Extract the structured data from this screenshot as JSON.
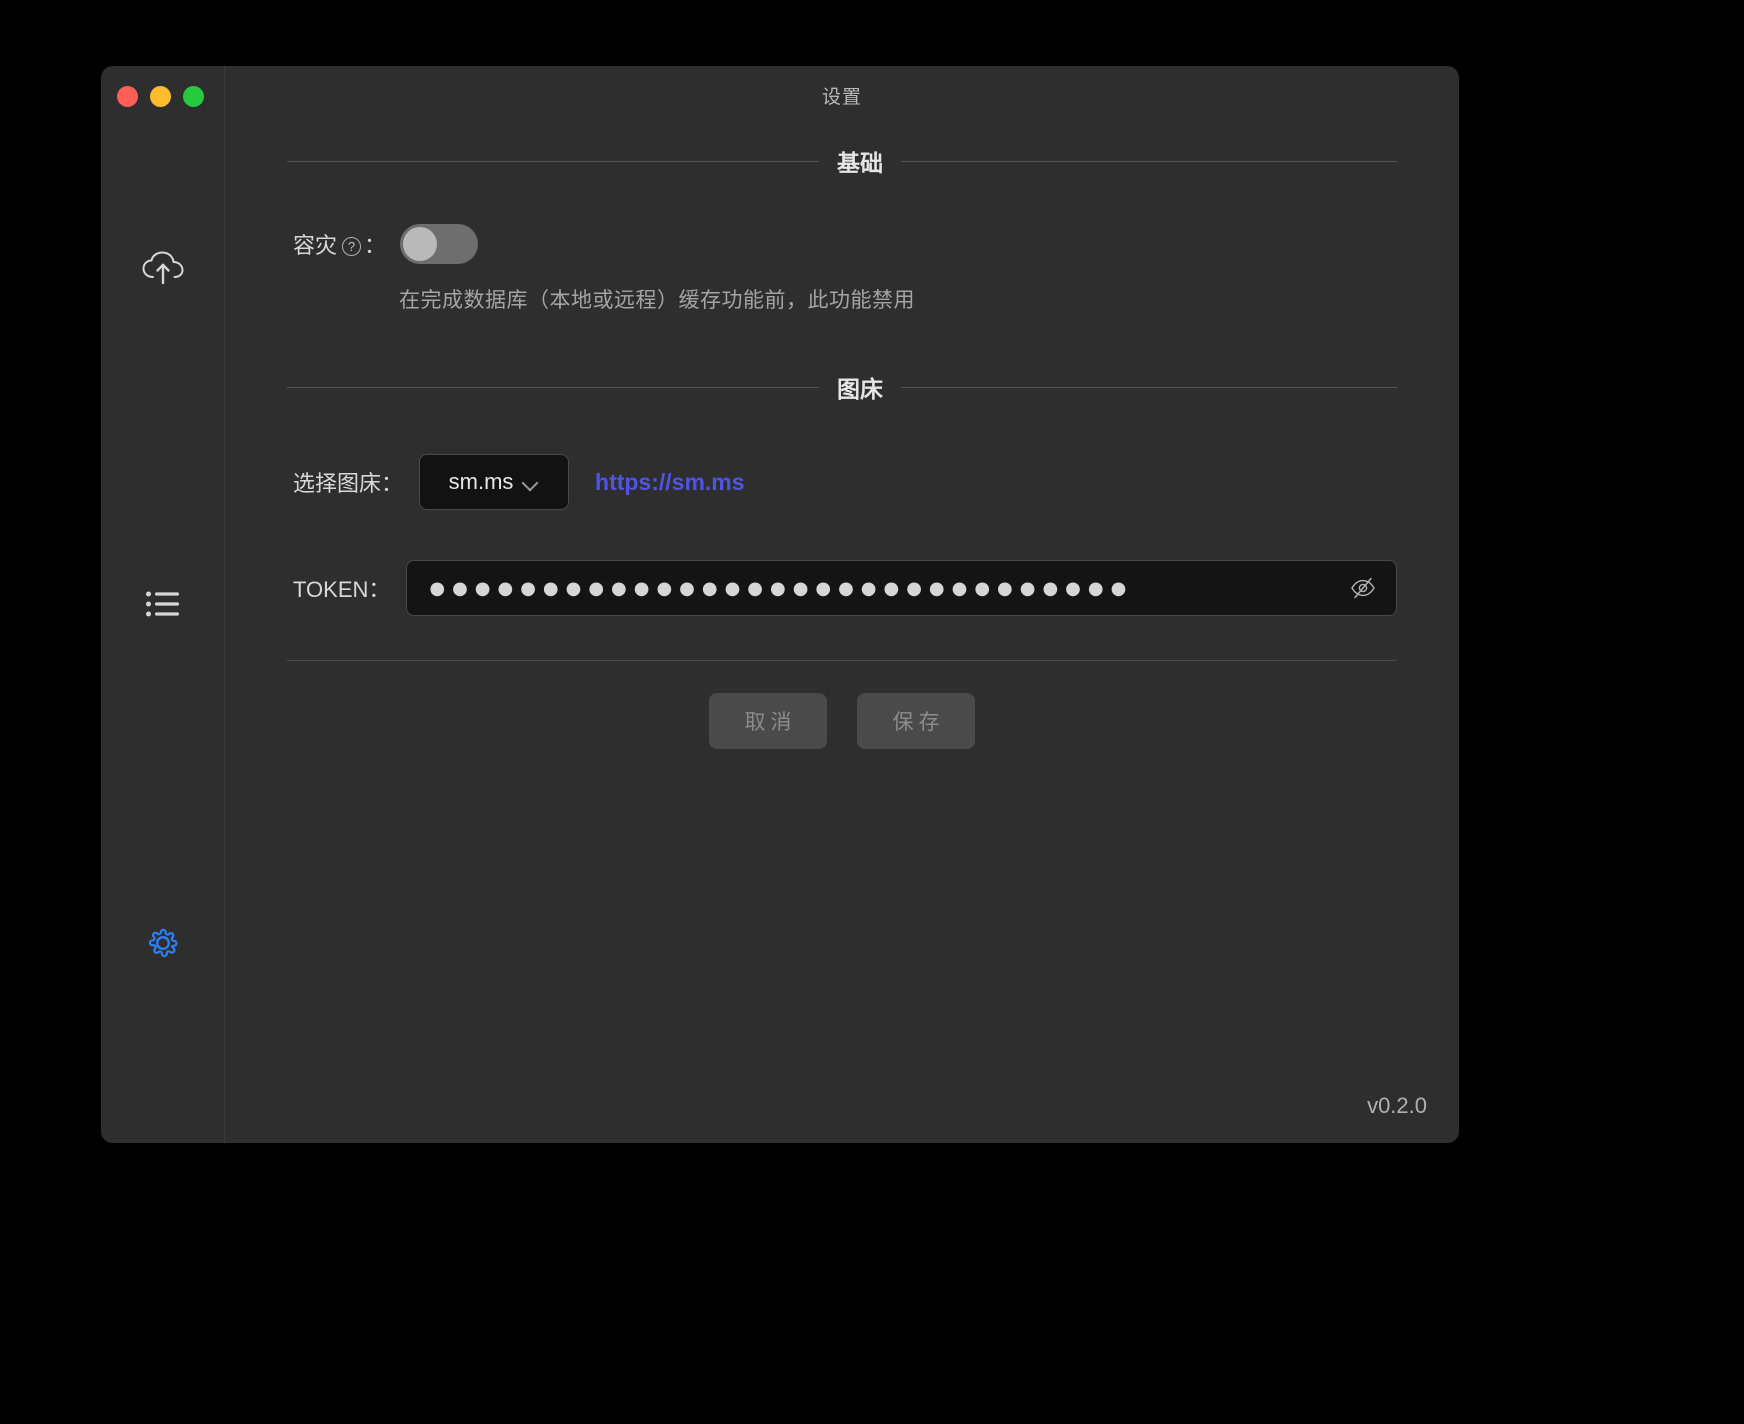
{
  "window": {
    "title": "设置",
    "traffic_lights": {
      "close_color": "#ff5f56",
      "minimize_color": "#ffbd2e",
      "maximize_color": "#27c93f"
    },
    "version": "v0.2.0"
  },
  "sidebar": {
    "items": [
      {
        "name": "upload",
        "icon": "cloud-upload-icon",
        "active": false
      },
      {
        "name": "list",
        "icon": "list-icon",
        "active": false
      },
      {
        "name": "settings",
        "icon": "gear-icon",
        "active": true
      }
    ],
    "active_color": "#2d7ff9"
  },
  "sections": [
    {
      "key": "basic",
      "label": "基础"
    },
    {
      "key": "image_host",
      "label": "图床"
    }
  ],
  "basic": {
    "disaster_recovery": {
      "label": "容灾",
      "help_glyph": "?",
      "colon": "：",
      "enabled": false,
      "hint": "在完成数据库（本地或远程）缓存功能前，此功能禁用"
    }
  },
  "image_host": {
    "select_label": "选择图床：",
    "selected": "sm.ms",
    "options": [
      "sm.ms"
    ],
    "link_text": "https://sm.ms",
    "link_color": "#4f54e8",
    "token_label": "TOKEN：",
    "token_masked": "●●●●●●●●●●●●●●●●●●●●●●●●●●●●●●●",
    "token_visibility_icon": "eye-off-icon"
  },
  "actions": {
    "cancel_label": "取消",
    "save_label": "保存"
  }
}
